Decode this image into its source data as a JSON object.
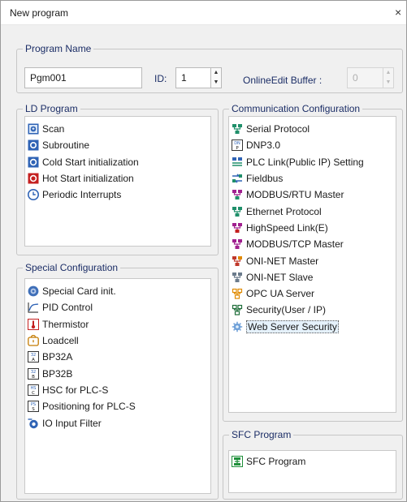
{
  "window": {
    "title": "New program",
    "close_label": "×"
  },
  "program_name": {
    "legend": "Program Name",
    "name_value": "Pgm001",
    "id_label": "ID:",
    "id_value": "1",
    "buffer_label": "OnlineEdit Buffer :",
    "buffer_value": "0"
  },
  "ld_program": {
    "legend": "LD Program",
    "items": [
      {
        "label": "Scan",
        "icon": "scan-icon"
      },
      {
        "label": "Subroutine",
        "icon": "subroutine-icon"
      },
      {
        "label": "Cold Start initialization",
        "icon": "cold-start-icon"
      },
      {
        "label": "Hot Start initialization",
        "icon": "hot-start-icon"
      },
      {
        "label": "Periodic Interrupts",
        "icon": "clock-icon"
      }
    ]
  },
  "special_configuration": {
    "legend": "Special Configuration",
    "items": [
      {
        "label": "Special Card init.",
        "icon": "special-card-icon"
      },
      {
        "label": "PID Control",
        "icon": "pid-icon"
      },
      {
        "label": "Thermistor",
        "icon": "thermistor-icon"
      },
      {
        "label": "Loadcell",
        "icon": "loadcell-icon"
      },
      {
        "label": "BP32A",
        "icon": "bp32a-icon"
      },
      {
        "label": "BP32B",
        "icon": "bp32b-icon"
      },
      {
        "label": "HSC for PLC-S",
        "icon": "hsc-icon"
      },
      {
        "label": "Positioning for PLC-S",
        "icon": "positioning-icon"
      },
      {
        "label": "IO Input Filter",
        "icon": "io-filter-icon"
      }
    ]
  },
  "communication_configuration": {
    "legend": "Communication Configuration",
    "items": [
      {
        "label": "Serial Protocol",
        "icon": "serial-protocol-icon"
      },
      {
        "label": "DNP3.0",
        "icon": "dnp3-icon"
      },
      {
        "label": "PLC Link(Public IP) Setting",
        "icon": "plc-link-icon"
      },
      {
        "label": "Fieldbus",
        "icon": "fieldbus-icon"
      },
      {
        "label": "MODBUS/RTU Master",
        "icon": "modbus-rtu-icon"
      },
      {
        "label": "Ethernet Protocol",
        "icon": "ethernet-protocol-icon"
      },
      {
        "label": "HighSpeed Link(E)",
        "icon": "highspeed-link-icon"
      },
      {
        "label": "MODBUS/TCP Master",
        "icon": "modbus-tcp-icon"
      },
      {
        "label": "ONI-NET Master",
        "icon": "oni-net-master-icon"
      },
      {
        "label": "ONI-NET Slave",
        "icon": "oni-net-slave-icon"
      },
      {
        "label": "OPC UA Server",
        "icon": "opc-ua-icon"
      },
      {
        "label": "Security(User / IP)",
        "icon": "security-icon"
      },
      {
        "label": "Web Server Security",
        "icon": "gear-icon",
        "selected": true
      }
    ]
  },
  "sfc_program": {
    "legend": "SFC Program",
    "items": [
      {
        "label": "SFC Program",
        "icon": "sfc-icon"
      }
    ]
  }
}
